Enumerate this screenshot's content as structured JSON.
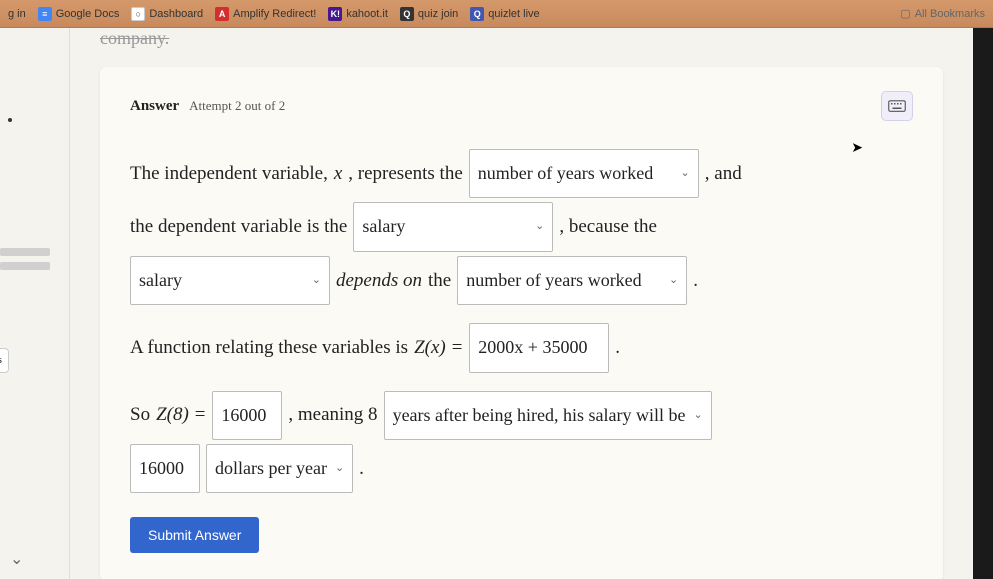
{
  "bookmarks": {
    "items": [
      {
        "label": "g in",
        "icon_bg": "#888",
        "icon_txt": ""
      },
      {
        "label": "Google Docs",
        "icon_bg": "#4285f4",
        "icon_txt": "≡"
      },
      {
        "label": "Dashboard",
        "icon_bg": "#fff",
        "icon_txt": "○"
      },
      {
        "label": "Amplify Redirect!",
        "icon_bg": "#d32f2f",
        "icon_txt": "A"
      },
      {
        "label": "kahoot.it",
        "icon_bg": "#46178f",
        "icon_txt": "K!"
      },
      {
        "label": "quiz join",
        "icon_bg": "#333",
        "icon_txt": "Q"
      },
      {
        "label": "quizlet live",
        "icon_bg": "#4257b2",
        "icon_txt": "Q"
      }
    ],
    "all_bookmarks": "All Bookmarks"
  },
  "page": {
    "company_strike": "company."
  },
  "answer": {
    "label": "Answer",
    "attempt": "Attempt 2 out of 2"
  },
  "problem": {
    "line1_a": "The independent variable,",
    "line1_var": "x",
    "line1_b": ", represents the",
    "dd1_value": "number of years worked",
    "line1_c": ", and",
    "line2_a": "the dependent variable is the",
    "dd2_value": "salary",
    "line2_b": ", because the",
    "dd3_value": "salary",
    "line3_a": "depends on",
    "line3_b": "the",
    "dd4_value": "number of years worked",
    "line3_c": ".",
    "line4_a": "A function relating these variables is",
    "line4_func": "Z(x) =",
    "input1_value": "2000x + 35000",
    "line4_b": ".",
    "line5_a": "So",
    "line5_func": "Z(8) =",
    "input2_value": "16000",
    "line5_b": ", meaning 8",
    "dd5_value": "years after being hired, his salary will be",
    "input3_value": "16000",
    "dd6_value": "dollars per year",
    "line6_b": "."
  },
  "actions": {
    "submit": "Submit Answer"
  },
  "nav": {
    "tab_label": "s"
  }
}
